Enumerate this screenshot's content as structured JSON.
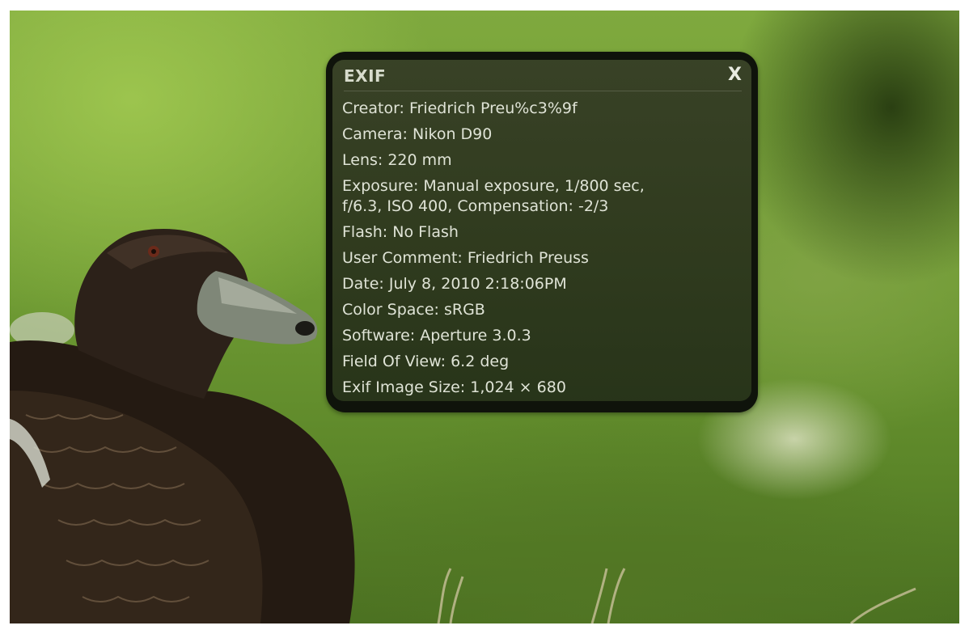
{
  "panel": {
    "title": "EXIF",
    "close_label": "X"
  },
  "exif": [
    {
      "line": "Creator: Friedrich Preu%c3%9f"
    },
    {
      "line": "Camera: Nikon D90"
    },
    {
      "line": "Lens: 220 mm"
    },
    {
      "line": "Exposure: Manual exposure, 1/800 sec,\nf/6.3, ISO 400, Compensation: -2/3"
    },
    {
      "line": "Flash: No Flash"
    },
    {
      "line": "User Comment: Friedrich Preuss"
    },
    {
      "line": "Date: July 8, 2010 2:18:06PM"
    },
    {
      "line": "Color Space: sRGB"
    },
    {
      "line": "Software: Aperture 3.0.3"
    },
    {
      "line": "Field Of View: 6.2 deg"
    },
    {
      "line": "Exif Image Size: 1,024 × 680"
    }
  ]
}
